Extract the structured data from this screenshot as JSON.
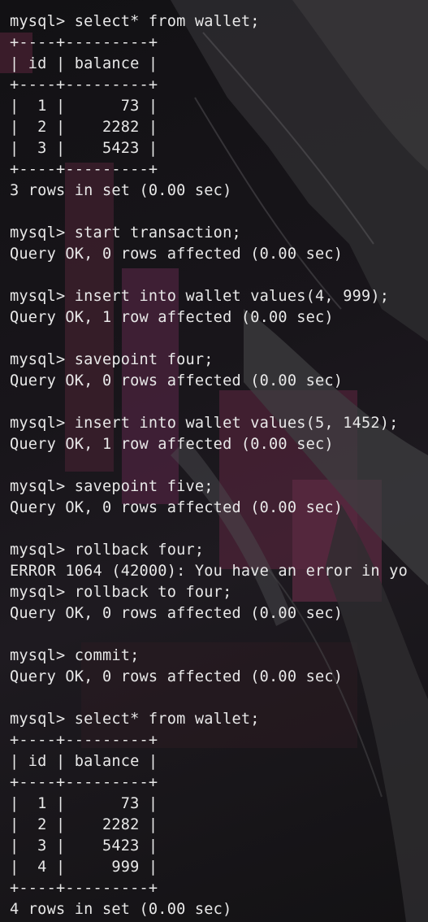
{
  "terminal": {
    "lines": [
      "mysql> select* from wallet;",
      "+----+---------+",
      "| id | balance |",
      "+----+---------+",
      "|  1 |      73 |",
      "|  2 |    2282 |",
      "|  3 |    5423 |",
      "+----+---------+",
      "3 rows in set (0.00 sec)",
      "",
      "mysql> start transaction;",
      "Query OK, 0 rows affected (0.00 sec)",
      "",
      "mysql> insert into wallet values(4, 999);",
      "Query OK, 1 row affected (0.00 sec)",
      "",
      "mysql> savepoint four;",
      "Query OK, 0 rows affected (0.00 sec)",
      "",
      "mysql> insert into wallet values(5, 1452);",
      "Query OK, 1 row affected (0.00 sec)",
      "",
      "mysql> savepoint five;",
      "Query OK, 0 rows affected (0.00 sec)",
      "",
      "mysql> rollback four;",
      "ERROR 1064 (42000): You have an error in yo",
      "mysql> rollback to four;",
      "Query OK, 0 rows affected (0.00 sec)",
      "",
      "mysql> commit;",
      "Query OK, 0 rows affected (0.00 sec)",
      "",
      "mysql> select* from wallet;",
      "+----+---------+",
      "| id | balance |",
      "+----+---------+",
      "|  1 |      73 |",
      "|  2 |    2282 |",
      "|  3 |    5423 |",
      "|  4 |     999 |",
      "+----+---------+",
      "4 rows in set (0.00 sec)"
    ]
  },
  "colors": {
    "text": "#e8e8e8",
    "background": "#0e0d0f",
    "accent": "#6e2a45"
  }
}
